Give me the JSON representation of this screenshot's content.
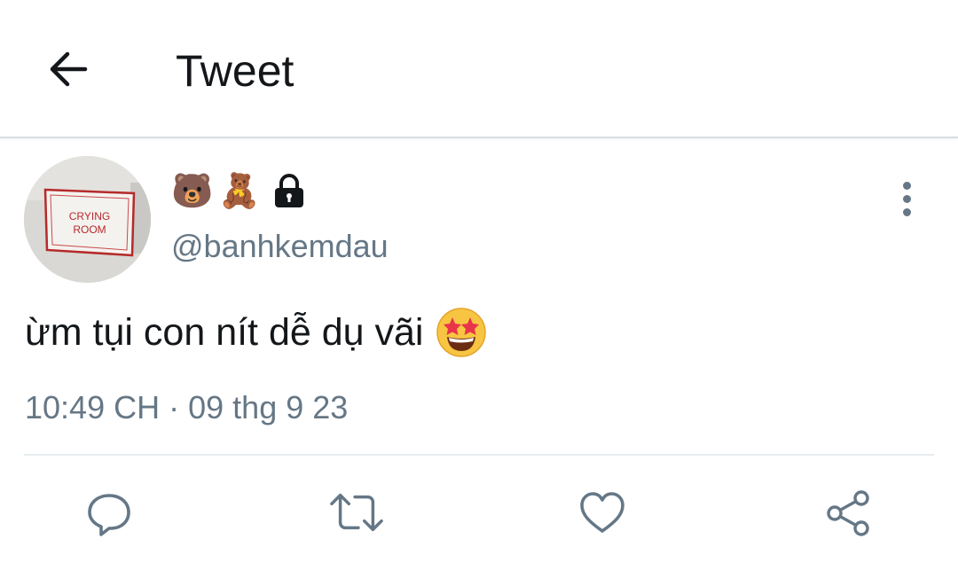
{
  "header": {
    "title": "Tweet",
    "back_icon": "arrow-left-icon"
  },
  "avatar": {
    "sign_line1": "CRYING",
    "sign_line2": "ROOM"
  },
  "user": {
    "name_emojis": [
      "🐻",
      "🧸"
    ],
    "lock_icon": "lock-icon",
    "handle": "@banhkemdau"
  },
  "tweet": {
    "text": "ừm tụi con nít dễ dụ vãi",
    "emoji_icon": "star-struck-emoji-icon",
    "time": "10:49 CH",
    "separator": "·",
    "date": "09 thg 9 23"
  },
  "actions": {
    "icons": [
      "reply-icon",
      "retweet-icon",
      "like-icon",
      "share-icon"
    ],
    "icon_color": "#657786"
  }
}
